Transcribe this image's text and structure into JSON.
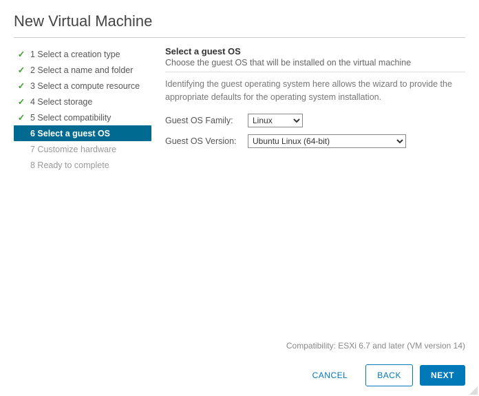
{
  "dialog": {
    "title": "New Virtual Machine"
  },
  "sidebar": {
    "steps": [
      {
        "label": "1 Select a creation type",
        "state": "done"
      },
      {
        "label": "2 Select a name and folder",
        "state": "done"
      },
      {
        "label": "3 Select a compute resource",
        "state": "done"
      },
      {
        "label": "4 Select storage",
        "state": "done"
      },
      {
        "label": "5 Select compatibility",
        "state": "done"
      },
      {
        "label": "6 Select a guest OS",
        "state": "active"
      },
      {
        "label": "7 Customize hardware",
        "state": "future"
      },
      {
        "label": "8 Ready to complete",
        "state": "future"
      }
    ]
  },
  "content": {
    "heading": "Select a guest OS",
    "subheading": "Choose the guest OS that will be installed on the virtual machine",
    "description": "Identifying the guest operating system here allows the wizard to provide the appropriate defaults for the operating system installation.",
    "family_label": "Guest OS Family:",
    "family_value": "Linux",
    "version_label": "Guest OS Version:",
    "version_value": "Ubuntu Linux (64-bit)"
  },
  "footer": {
    "compatibility": "Compatibility: ESXi 6.7 and later (VM version 14)",
    "cancel": "CANCEL",
    "back": "BACK",
    "next": "NEXT"
  }
}
